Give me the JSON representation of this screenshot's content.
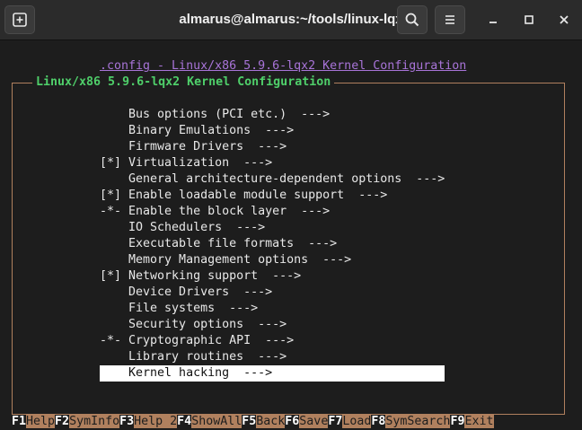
{
  "window": {
    "title": "almarus@almarus:~/tools/linux-lqx"
  },
  "header": {
    "config_title": ".config - Linux/x86 5.9.6-lqx2 Kernel Configuration",
    "frame_title": "Linux/x86 5.9.6-lqx2 Kernel Configuration"
  },
  "menu": {
    "items": [
      {
        "label": "    Bus options (PCI etc.)  --->",
        "selected": false
      },
      {
        "label": "    Binary Emulations  --->",
        "selected": false
      },
      {
        "label": "    Firmware Drivers  --->",
        "selected": false
      },
      {
        "label": "[*] Virtualization  --->",
        "selected": false
      },
      {
        "label": "    General architecture-dependent options  --->",
        "selected": false
      },
      {
        "label": "[*] Enable loadable module support  --->",
        "selected": false
      },
      {
        "label": "-*- Enable the block layer  --->",
        "selected": false
      },
      {
        "label": "    IO Schedulers  --->",
        "selected": false
      },
      {
        "label": "    Executable file formats  --->",
        "selected": false
      },
      {
        "label": "    Memory Management options  --->",
        "selected": false
      },
      {
        "label": "[*] Networking support  --->",
        "selected": false
      },
      {
        "label": "    Device Drivers  --->",
        "selected": false
      },
      {
        "label": "    File systems  --->",
        "selected": false
      },
      {
        "label": "    Security options  --->",
        "selected": false
      },
      {
        "label": "-*- Cryptographic API  --->",
        "selected": false
      },
      {
        "label": "    Library routines  --->",
        "selected": false
      },
      {
        "label": "    Kernel hacking  --->",
        "selected": true
      }
    ]
  },
  "fkeys": [
    {
      "key": "F1",
      "label": "Help"
    },
    {
      "key": "F2",
      "label": "SymInfo"
    },
    {
      "key": "F3",
      "label": "Help 2"
    },
    {
      "key": "F4",
      "label": "ShowAll"
    },
    {
      "key": "F5",
      "label": "Back"
    },
    {
      "key": "F6",
      "label": "Save"
    },
    {
      "key": "F7",
      "label": "Load"
    },
    {
      "key": "F8",
      "label": "SymSearch"
    },
    {
      "key": "F9",
      "label": "Exit"
    }
  ],
  "colors": {
    "background": "#1d1d1d",
    "frame": "#b0805e",
    "frame_title": "#4fcf6a",
    "config_title": "#a874d8"
  }
}
